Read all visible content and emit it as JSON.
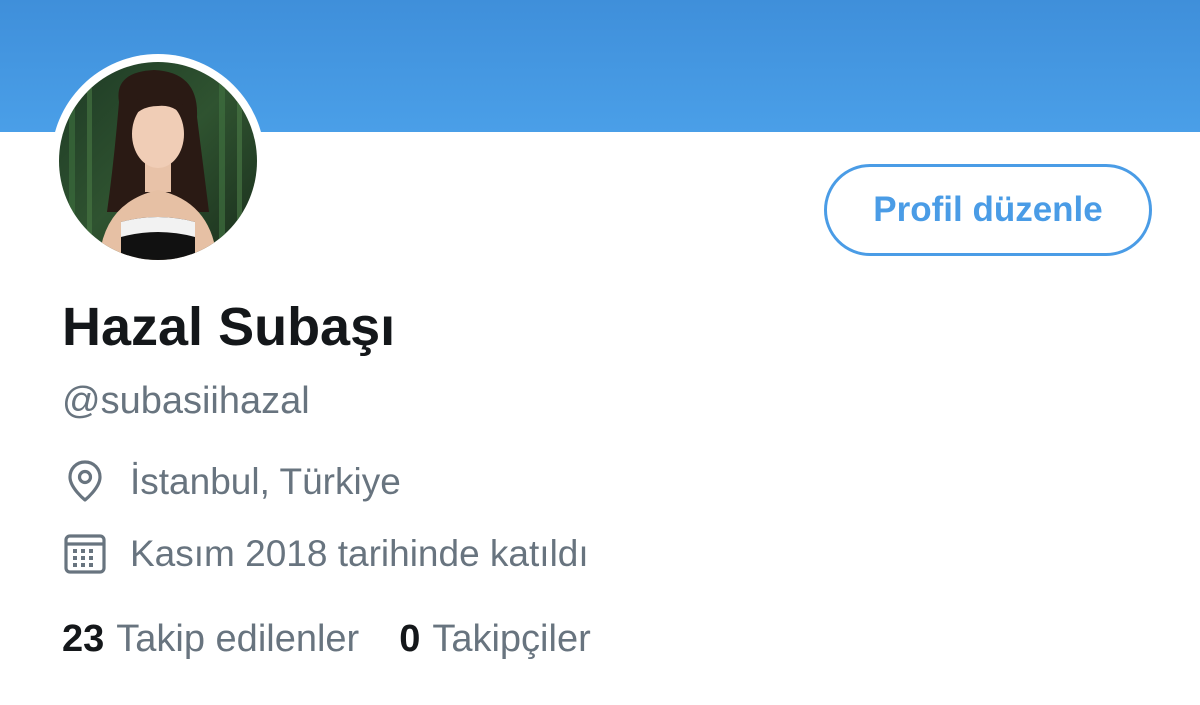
{
  "profile": {
    "display_name": "Hazal Subaşı",
    "handle": "@subasiihazal",
    "location": "İstanbul, Türkiye",
    "joined": "Kasım 2018 tarihinde katıldı",
    "edit_button_label": "Profil düzenle"
  },
  "stats": {
    "following_count": "23",
    "following_label": "Takip edilenler",
    "followers_count": "0",
    "followers_label": "Takipçiler"
  },
  "icons": {
    "location": "location-pin-icon",
    "joined": "calendar-icon"
  },
  "colors": {
    "banner": "#4a9fe8",
    "accent": "#4a9ce6",
    "text_primary": "#14171a",
    "text_secondary": "#68747f"
  }
}
